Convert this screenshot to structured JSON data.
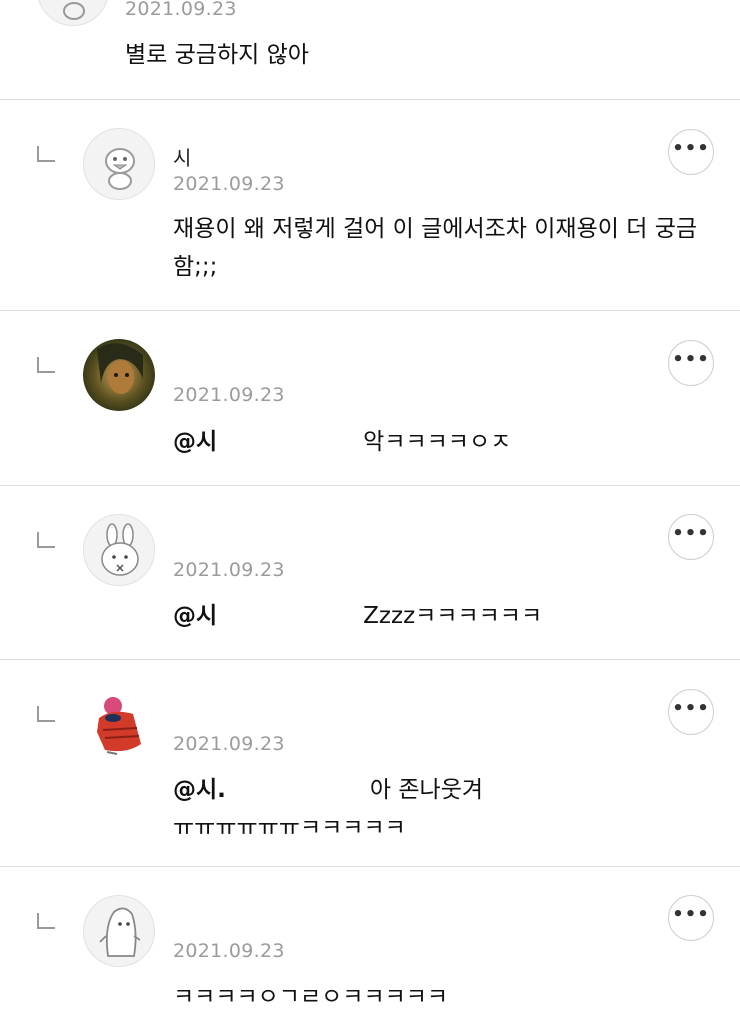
{
  "comments": [
    {
      "date": "2021.09.23",
      "text": "별로 궁금하지 않아"
    },
    {
      "nickname": "시",
      "date": "2021.09.23",
      "text": "재용이 왜 저렇게 걸어 이 글에서조차 이재용이 더 궁금함;;;"
    },
    {
      "date": "2021.09.23",
      "mention": "@시",
      "text": "악ㅋㅋㅋㅋㅇㅈ"
    },
    {
      "date": "2021.09.23",
      "mention": "@시",
      "text": "Zzzzㅋㅋㅋㅋㅋㅋ"
    },
    {
      "date": "2021.09.23",
      "mention": "@시.",
      "text_line1": "아 존나웃겨",
      "text_line2": "ㅠㅠㅠㅠㅠㅠㅋㅋㅋㅋㅋ"
    },
    {
      "date": "2021.09.23",
      "text": "ㅋㅋㅋㅋㅇㄱㄹㅇㅋㅋㅋㅋㅋ"
    }
  ],
  "more_button_label": "•••",
  "icons": [
    "reply-arrow-icon",
    "more-options-icon",
    "avatar"
  ]
}
